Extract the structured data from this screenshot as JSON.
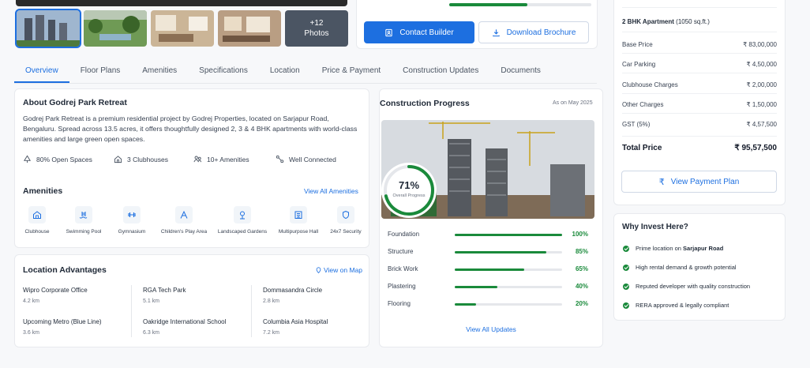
{
  "gallery": {
    "more_count": "+12",
    "more_label": "Photos"
  },
  "actions": {
    "contact": "Contact Builder",
    "brochure": "Download Brochure"
  },
  "tabs": [
    "Overview",
    "Floor Plans",
    "Amenities",
    "Specifications",
    "Location",
    "Price & Payment",
    "Construction Updates",
    "Documents"
  ],
  "about": {
    "title": "About Godrej Park Retreat",
    "text": "Godrej Park Retreat is a premium residential project by Godrej Properties, located on Sarjapur Road, Bengaluru. Spread across 13.5 acres, it offers thoughtfully designed 2, 3 & 4 BHK apartments with world-class amenities and large green open spaces.",
    "features": [
      "80% Open Spaces",
      "3 Clubhouses",
      "10+ Amenities",
      "Well Connected"
    ]
  },
  "amenities": {
    "title": "Amenities",
    "view_all": "View All Amenities",
    "items": [
      "Clubhouse",
      "Swimming Pool",
      "Gymnasium",
      "Children's Play Area",
      "Landscaped Gardens",
      "Multipurpose Hall",
      "24x7 Security"
    ]
  },
  "location": {
    "title": "Location Advantages",
    "view_map": "View on Map",
    "items": [
      {
        "name": "Wipro Corporate Office",
        "dist": "4.2 km"
      },
      {
        "name": "RGA Tech Park",
        "dist": "5.1 km"
      },
      {
        "name": "Dommasandra Circle",
        "dist": "2.8 km"
      },
      {
        "name": "Upcoming Metro (Blue Line)",
        "dist": "3.6 km"
      },
      {
        "name": "Oakridge International School",
        "dist": "6.3 km"
      },
      {
        "name": "Columbia Asia Hospital",
        "dist": "7.2 km"
      }
    ]
  },
  "construction": {
    "title": "Construction Progress",
    "as_on": "As on May 2025",
    "overall_pct": "71%",
    "overall_value": 0.71,
    "overall_label": "Overall Progress",
    "stages": [
      {
        "name": "Foundation",
        "pct": "100%",
        "value": 1.0
      },
      {
        "name": "Structure",
        "pct": "85%",
        "value": 0.85
      },
      {
        "name": "Brick Work",
        "pct": "65%",
        "value": 0.65
      },
      {
        "name": "Plastering",
        "pct": "40%",
        "value": 0.4
      },
      {
        "name": "Flooring",
        "pct": "20%",
        "value": 0.2
      }
    ],
    "view_all": "View All Updates"
  },
  "price": {
    "unit": "2 BHK Apartment",
    "area": "(1050 sq.ft.)",
    "rows": [
      {
        "label": "Base Price",
        "value": "₹ 83,00,000"
      },
      {
        "label": "Car Parking",
        "value": "₹ 4,50,000"
      },
      {
        "label": "Clubhouse Charges",
        "value": "₹ 2,00,000"
      },
      {
        "label": "Other Charges",
        "value": "₹ 1,50,000"
      },
      {
        "label": "GST (5%)",
        "value": "₹ 4,57,500"
      }
    ],
    "total_label": "Total Price",
    "total_value": "₹ 95,57,500",
    "plan_button": "View Payment Plan"
  },
  "why": {
    "title": "Why Invest Here?",
    "items": [
      {
        "text": "Prime location on ",
        "bold": "Sarjapur Road"
      },
      {
        "text": "High rental demand & growth potential",
        "bold": ""
      },
      {
        "text": "Reputed developer with quality construction",
        "bold": ""
      },
      {
        "text": "RERA approved & legally compliant",
        "bold": ""
      }
    ]
  },
  "colors": {
    "primary": "#1d6fe0",
    "success": "#1a8a3b"
  }
}
